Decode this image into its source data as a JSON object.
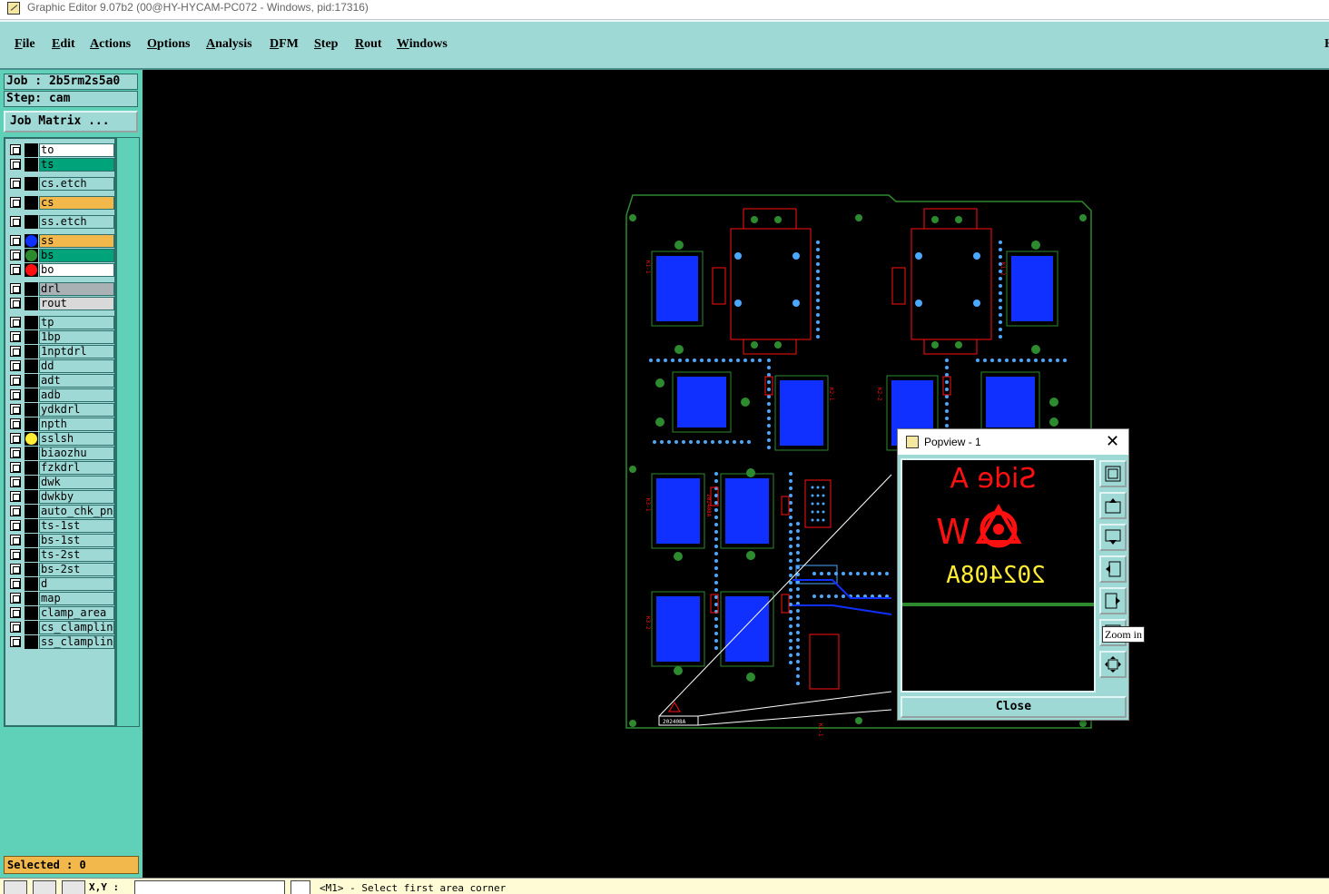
{
  "window": {
    "title": "Graphic Editor 9.07b2 (00@HY-HYCAM-PC072 - Windows, pid:17316)"
  },
  "menu": {
    "items": [
      {
        "first": "F",
        "rest": "ile"
      },
      {
        "first": "E",
        "rest": "dit"
      },
      {
        "first": "A",
        "rest": "ctions"
      },
      {
        "first": "O",
        "rest": "ptions"
      },
      {
        "first": "A",
        "rest": "nalysis"
      },
      {
        "first": "D",
        "rest": "FM"
      },
      {
        "first": "S",
        "rest": "tep"
      },
      {
        "first": "R",
        "rest": "out"
      },
      {
        "first": "W",
        "rest": "indows"
      }
    ],
    "right_tag": "H"
  },
  "panel": {
    "job": "Job : 2b5rm2s5a0",
    "step": "Step: cam",
    "job_matrix": "Job Matrix ...",
    "selected": "Selected : 0"
  },
  "layers": [
    {
      "name": "to",
      "bg": "#ffffff",
      "dot": ""
    },
    {
      "name": "ts",
      "bg": "#00a37a",
      "dot": ""
    },
    {
      "name": "cs.etch",
      "bg": "#9fd9d6",
      "dot": ""
    },
    {
      "name": "cs",
      "bg": "#f2b84b",
      "dot": ""
    },
    {
      "name": "ss.etch",
      "bg": "#9fd9d6",
      "dot": ""
    },
    {
      "name": "ss",
      "bg": "#f2b84b",
      "dot": "#1030ff"
    },
    {
      "name": "bs",
      "bg": "#00a37a",
      "dot": "#2e8a2e"
    },
    {
      "name": "bo",
      "bg": "#ffffff",
      "dot": "#ff1010"
    },
    {
      "name": "drl",
      "bg": "#a9b1b4",
      "dot": ""
    },
    {
      "name": "rout",
      "bg": "#d9d9d9",
      "dot": ""
    },
    {
      "name": "tp",
      "bg": "#9fd9d6",
      "dot": ""
    },
    {
      "name": "1bp",
      "bg": "#9fd9d6",
      "dot": ""
    },
    {
      "name": "1nptdrl",
      "bg": "#9fd9d6",
      "dot": ""
    },
    {
      "name": "dd",
      "bg": "#9fd9d6",
      "dot": ""
    },
    {
      "name": "adt",
      "bg": "#9fd9d6",
      "dot": ""
    },
    {
      "name": "adb",
      "bg": "#9fd9d6",
      "dot": ""
    },
    {
      "name": "ydkdrl",
      "bg": "#9fd9d6",
      "dot": ""
    },
    {
      "name": "npth",
      "bg": "#9fd9d6",
      "dot": ""
    },
    {
      "name": "sslsh",
      "bg": "#9fd9d6",
      "dot": "#ffee33"
    },
    {
      "name": "biaozhu",
      "bg": "#9fd9d6",
      "dot": ""
    },
    {
      "name": "fzkdrl",
      "bg": "#9fd9d6",
      "dot": ""
    },
    {
      "name": "dwk",
      "bg": "#9fd9d6",
      "dot": ""
    },
    {
      "name": "dwkby",
      "bg": "#9fd9d6",
      "dot": ""
    },
    {
      "name": "auto_chk_pnl",
      "bg": "#9fd9d6",
      "dot": ""
    },
    {
      "name": "ts-1st",
      "bg": "#9fd9d6",
      "dot": ""
    },
    {
      "name": "bs-1st",
      "bg": "#9fd9d6",
      "dot": ""
    },
    {
      "name": "ts-2st",
      "bg": "#9fd9d6",
      "dot": ""
    },
    {
      "name": "bs-2st",
      "bg": "#9fd9d6",
      "dot": ""
    },
    {
      "name": "d",
      "bg": "#9fd9d6",
      "dot": ""
    },
    {
      "name": "map",
      "bg": "#9fd9d6",
      "dot": ""
    },
    {
      "name": "clamp_area",
      "bg": "#9fd9d6",
      "dot": ""
    },
    {
      "name": "cs_clampline",
      "bg": "#9fd9d6",
      "dot": ""
    },
    {
      "name": "ss_clampline",
      "bg": "#9fd9d6",
      "dot": ""
    }
  ],
  "popview": {
    "title": "Popview - 1",
    "close_x": "✕",
    "close_button": "Close",
    "side_text": "Side A",
    "w_text": "W",
    "code_text": "202408A",
    "tools": [
      "zoom-reset-icon",
      "pan-up-icon",
      "pan-down-icon",
      "pan-left-icon",
      "pan-right-icon",
      "zoom-in-icon",
      "zoom-fit-icon"
    ]
  },
  "tooltip": "Zoom in",
  "statusbar": {
    "xy_label": "X,Y :",
    "xy_value": "",
    "message": "<M1> - Select first area corner"
  },
  "board": {
    "labels": [
      "K1-1",
      "K1-2",
      "K2-1",
      "K2-2",
      "K3-1",
      "K3-2",
      "202408A"
    ],
    "board_text": "202408A"
  },
  "colors": {
    "menu_bg": "#9fd9d6",
    "panel_bg": "#5fd1b9",
    "board_outline": "#2e8a2e",
    "pad_blue": "#1030ff",
    "trace_cyan": "#4aa8ff",
    "silk_red": "#ff1010"
  }
}
